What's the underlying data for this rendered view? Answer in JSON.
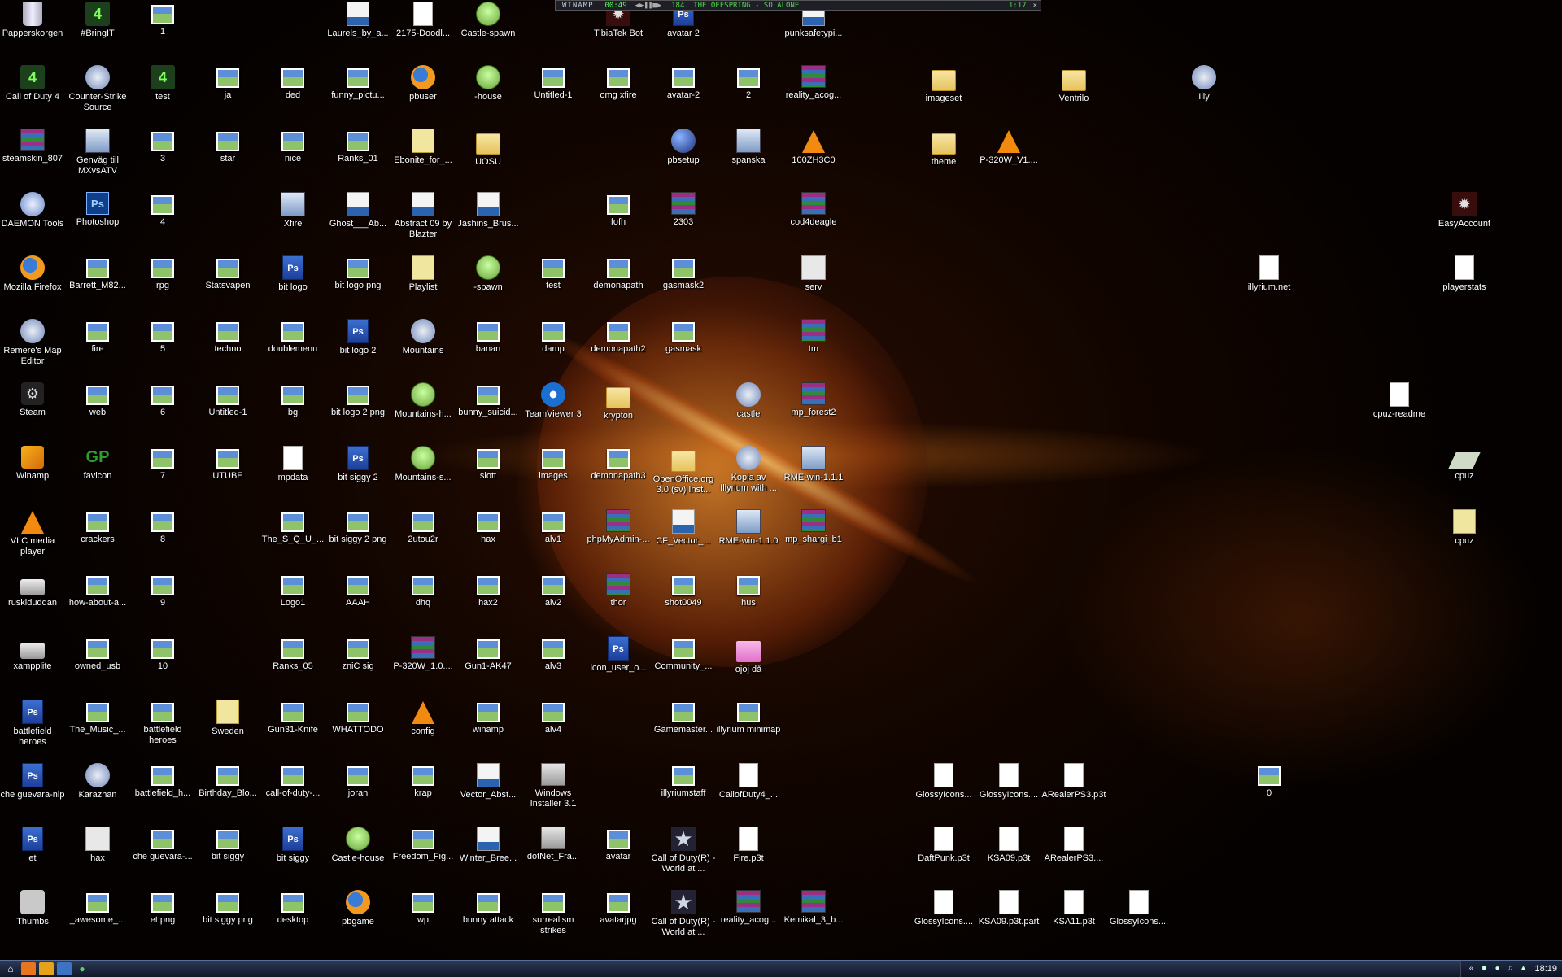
{
  "winamp": {
    "title": "WINAMP",
    "time": "00:49",
    "song": "184. THE OFFSPRING - SO ALONE",
    "length": "1:17"
  },
  "taskbar": {
    "clock": "18:19"
  },
  "icons": [
    {
      "label": "Papperskorgen",
      "type": "bin"
    },
    {
      "label": "#BringIT",
      "type": "cod"
    },
    {
      "label": "1",
      "type": "img"
    },
    {
      "label": "Laurels_by_a...",
      "type": "brush"
    },
    {
      "label": "2175-Doodl...",
      "type": "file"
    },
    {
      "label": "Castle-spawn",
      "type": "ie"
    },
    {
      "label": "TibiaTek Bot",
      "type": "bug"
    },
    {
      "label": "avatar 2",
      "type": "psd"
    },
    {
      "label": "punksafetypi...",
      "type": "brush"
    },
    {
      "label": "Call of Duty 4",
      "type": "cod"
    },
    {
      "label": "Counter-Strike Source",
      "type": "cs"
    },
    {
      "label": "test",
      "type": "cod"
    },
    {
      "label": "ja",
      "type": "img"
    },
    {
      "label": "ded",
      "type": "img"
    },
    {
      "label": "funny_pictu...",
      "type": "img"
    },
    {
      "label": "pbuser",
      "type": "ff"
    },
    {
      "label": "-house",
      "type": "ie"
    },
    {
      "label": "Untitled-1",
      "type": "img"
    },
    {
      "label": "omg xfire",
      "type": "img"
    },
    {
      "label": "avatar-2",
      "type": "img"
    },
    {
      "label": "2",
      "type": "img"
    },
    {
      "label": "reality_acog...",
      "type": "rar"
    },
    {
      "label": "imageset",
      "type": "folder"
    },
    {
      "label": "Ventrilo",
      "type": "folder"
    },
    {
      "label": "Illy",
      "type": "cs"
    },
    {
      "label": "steamskin_807",
      "type": "rar"
    },
    {
      "label": "Genväg till MXvsATV",
      "type": "exe"
    },
    {
      "label": "3",
      "type": "img"
    },
    {
      "label": "star",
      "type": "img"
    },
    {
      "label": "nice",
      "type": "img"
    },
    {
      "label": "Ranks_01",
      "type": "img"
    },
    {
      "label": "Ebonite_for_...",
      "type": "mag"
    },
    {
      "label": "UOSU",
      "type": "folder"
    },
    {
      "label": "pbsetup",
      "type": "net"
    },
    {
      "label": "spanska",
      "type": "exe"
    },
    {
      "label": "100ZH3C0",
      "type": "vlc"
    },
    {
      "label": "theme",
      "type": "folder"
    },
    {
      "label": "P-320W_V1....",
      "type": "vlc"
    },
    {
      "label": "DAEMON Tools",
      "type": "daemon"
    },
    {
      "label": "Photoshop",
      "type": "ps"
    },
    {
      "label": "4",
      "type": "img"
    },
    {
      "label": "Xfire",
      "type": "exe"
    },
    {
      "label": "Ghost___Ab...",
      "type": "brush"
    },
    {
      "label": "Abstract 09 by Blazter",
      "type": "brush"
    },
    {
      "label": "Jashins_Brus...",
      "type": "brush"
    },
    {
      "label": "fofh",
      "type": "img"
    },
    {
      "label": "2303",
      "type": "rar"
    },
    {
      "label": "cod4deagle",
      "type": "rar"
    },
    {
      "label": "EasyAccount",
      "type": "bug"
    },
    {
      "label": "Mozilla Firefox",
      "type": "ff"
    },
    {
      "label": "Barrett_M82...",
      "type": "img"
    },
    {
      "label": "rpg",
      "type": "img"
    },
    {
      "label": "Statsvapen",
      "type": "img"
    },
    {
      "label": "bit logo",
      "type": "psd"
    },
    {
      "label": "bit logo png",
      "type": "img"
    },
    {
      "label": "Playlist",
      "type": "mag"
    },
    {
      "label": "-spawn",
      "type": "ie"
    },
    {
      "label": "test",
      "type": "img"
    },
    {
      "label": "demonapath",
      "type": "img"
    },
    {
      "label": "gasmask2",
      "type": "img"
    },
    {
      "label": "serv",
      "type": "gift"
    },
    {
      "label": "illyrium.net",
      "type": "file"
    },
    {
      "label": "playerstats",
      "type": "file"
    },
    {
      "label": "Remere's Map Editor",
      "type": "cs"
    },
    {
      "label": "fire",
      "type": "img"
    },
    {
      "label": "5",
      "type": "img"
    },
    {
      "label": "techno",
      "type": "img"
    },
    {
      "label": "doublemenu",
      "type": "img"
    },
    {
      "label": "bit logo 2",
      "type": "psd"
    },
    {
      "label": "Mountains",
      "type": "cs"
    },
    {
      "label": "banan",
      "type": "img"
    },
    {
      "label": "damp",
      "type": "img"
    },
    {
      "label": "demonapath2",
      "type": "img"
    },
    {
      "label": "gasmask",
      "type": "img"
    },
    {
      "label": "tm",
      "type": "rar"
    },
    {
      "label": "Steam",
      "type": "steam"
    },
    {
      "label": "web",
      "type": "img"
    },
    {
      "label": "6",
      "type": "img"
    },
    {
      "label": "Untitled-1",
      "type": "img"
    },
    {
      "label": "bg",
      "type": "img"
    },
    {
      "label": "bit logo 2 png",
      "type": "img"
    },
    {
      "label": "Mountains-h...",
      "type": "ie"
    },
    {
      "label": "bunny_suicid...",
      "type": "img"
    },
    {
      "label": "TeamViewer 3",
      "type": "tv"
    },
    {
      "label": "krypton",
      "type": "folder"
    },
    {
      "label": "castle",
      "type": "cs"
    },
    {
      "label": "mp_forest2",
      "type": "rar"
    },
    {
      "label": "cpuz-readme",
      "type": "file"
    },
    {
      "label": "Winamp",
      "type": "winamp"
    },
    {
      "label": "favicon",
      "type": "gp"
    },
    {
      "label": "7",
      "type": "img"
    },
    {
      "label": "UTUBE",
      "type": "img"
    },
    {
      "label": "mpdata",
      "type": "file"
    },
    {
      "label": "bit siggy 2",
      "type": "psd"
    },
    {
      "label": "Mountains-s...",
      "type": "ie"
    },
    {
      "label": "slott",
      "type": "img"
    },
    {
      "label": "images",
      "type": "img"
    },
    {
      "label": "demonapath3",
      "type": "img"
    },
    {
      "label": "OpenOffice.org 3.0 (sv) Inst...",
      "type": "folder"
    },
    {
      "label": "Kopia av Illyrium with ...",
      "type": "cs"
    },
    {
      "label": "RME-win-1.1.1",
      "type": "exe"
    },
    {
      "label": "cpuz",
      "type": "dia"
    },
    {
      "label": "VLC media player",
      "type": "vlc"
    },
    {
      "label": "crackers",
      "type": "img"
    },
    {
      "label": "8",
      "type": "img"
    },
    {
      "label": "The_S_Q_U_...",
      "type": "img"
    },
    {
      "label": "bit siggy 2 png",
      "type": "img"
    },
    {
      "label": "2utou2r",
      "type": "img"
    },
    {
      "label": "hax",
      "type": "img"
    },
    {
      "label": "alv1",
      "type": "img"
    },
    {
      "label": "phpMyAdmin-...",
      "type": "rar"
    },
    {
      "label": "CF_Vector_...",
      "type": "brush"
    },
    {
      "label": "RME-win-1.1.0",
      "type": "exe"
    },
    {
      "label": "mp_shargi_b1",
      "type": "rar"
    },
    {
      "label": "cpuz",
      "type": "mag"
    },
    {
      "label": "ruskiduddan",
      "type": "drive"
    },
    {
      "label": "how-about-a...",
      "type": "img"
    },
    {
      "label": "9",
      "type": "img"
    },
    {
      "label": "Logo1",
      "type": "img"
    },
    {
      "label": "AAAH",
      "type": "img"
    },
    {
      "label": "dhq",
      "type": "img"
    },
    {
      "label": "hax2",
      "type": "img"
    },
    {
      "label": "alv2",
      "type": "img"
    },
    {
      "label": "thor",
      "type": "rar"
    },
    {
      "label": "shot0049",
      "type": "img"
    },
    {
      "label": "hus",
      "type": "img"
    },
    {
      "label": "xampplite",
      "type": "drive"
    },
    {
      "label": "owned_usb",
      "type": "img"
    },
    {
      "label": "10",
      "type": "img"
    },
    {
      "label": "Ranks_05",
      "type": "img"
    },
    {
      "label": "zniC sig",
      "type": "img"
    },
    {
      "label": "P-320W_1.0....",
      "type": "rar"
    },
    {
      "label": "Gun1-AK47",
      "type": "img"
    },
    {
      "label": "alv3",
      "type": "img"
    },
    {
      "label": "icon_user_o...",
      "type": "psd"
    },
    {
      "label": "Community_...",
      "type": "img"
    },
    {
      "label": "ojoj då",
      "type": "pink"
    },
    {
      "label": "battlefield heroes",
      "type": "psd"
    },
    {
      "label": "The_Music_...",
      "type": "img"
    },
    {
      "label": "battlefield heroes",
      "type": "img"
    },
    {
      "label": "Sweden",
      "type": "mag"
    },
    {
      "label": "Gun31-Knife",
      "type": "img"
    },
    {
      "label": "WHATTODO",
      "type": "img"
    },
    {
      "label": "config",
      "type": "vlc"
    },
    {
      "label": "winamp",
      "type": "img"
    },
    {
      "label": "alv4",
      "type": "img"
    },
    {
      "label": "Gamemaster...",
      "type": "img"
    },
    {
      "label": "illyrium minimap",
      "type": "img"
    },
    {
      "label": "che guevara-nip",
      "type": "psd"
    },
    {
      "label": "Karazhan",
      "type": "cs"
    },
    {
      "label": "battlefield_h...",
      "type": "img"
    },
    {
      "label": "Birthday_Blo...",
      "type": "img"
    },
    {
      "label": "call-of-duty-...",
      "type": "img"
    },
    {
      "label": "joran",
      "type": "img"
    },
    {
      "label": "krap",
      "type": "img"
    },
    {
      "label": "Vector_Abst...",
      "type": "brush"
    },
    {
      "label": "Windows Installer 3.1",
      "type": "win"
    },
    {
      "label": "illyriumstaff",
      "type": "img"
    },
    {
      "label": "CallofDuty4_...",
      "type": "file"
    },
    {
      "label": "GlossyIcons...",
      "type": "file"
    },
    {
      "label": "GlossyIcons....",
      "type": "file"
    },
    {
      "label": "ARealerPS3.p3t",
      "type": "file"
    },
    {
      "label": "0",
      "type": "img"
    },
    {
      "label": "et",
      "type": "psd"
    },
    {
      "label": "hax",
      "type": "gift"
    },
    {
      "label": "che guevara-...",
      "type": "img"
    },
    {
      "label": "bit siggy",
      "type": "img"
    },
    {
      "label": "bit siggy",
      "type": "psd"
    },
    {
      "label": "Castle-house",
      "type": "ie"
    },
    {
      "label": "Freedom_Fig...",
      "type": "img"
    },
    {
      "label": "Winter_Bree...",
      "type": "brush"
    },
    {
      "label": "dotNet_Fra...",
      "type": "win"
    },
    {
      "label": "avatar",
      "type": "img"
    },
    {
      "label": "Call of Duty(R) - World at ...",
      "type": "star"
    },
    {
      "label": "Fire.p3t",
      "type": "file"
    },
    {
      "label": "DaftPunk.p3t",
      "type": "file"
    },
    {
      "label": "KSA09.p3t",
      "type": "file"
    },
    {
      "label": "ARealerPS3....",
      "type": "file"
    },
    {
      "label": "Thumbs",
      "type": "cfg"
    },
    {
      "label": "_awesome_...",
      "type": "img"
    },
    {
      "label": "et png",
      "type": "img"
    },
    {
      "label": "bit siggy png",
      "type": "img"
    },
    {
      "label": "desktop",
      "type": "img"
    },
    {
      "label": "pbgame",
      "type": "ff"
    },
    {
      "label": "wp",
      "type": "img"
    },
    {
      "label": "bunny attack",
      "type": "img"
    },
    {
      "label": "surrealism strikes",
      "type": "img"
    },
    {
      "label": "avatarjpg",
      "type": "img"
    },
    {
      "label": "Call of Duty(R) - World at ...",
      "type": "star"
    },
    {
      "label": "reality_acog...",
      "type": "rar"
    },
    {
      "label": "Kemikal_3_b...",
      "type": "rar"
    },
    {
      "label": "GlossyIcons....",
      "type": "file"
    },
    {
      "label": "KSA09.p3t.part",
      "type": "file"
    },
    {
      "label": "KSA11.p3t",
      "type": "file"
    },
    {
      "label": "GlossyIcons....",
      "type": "file"
    }
  ]
}
